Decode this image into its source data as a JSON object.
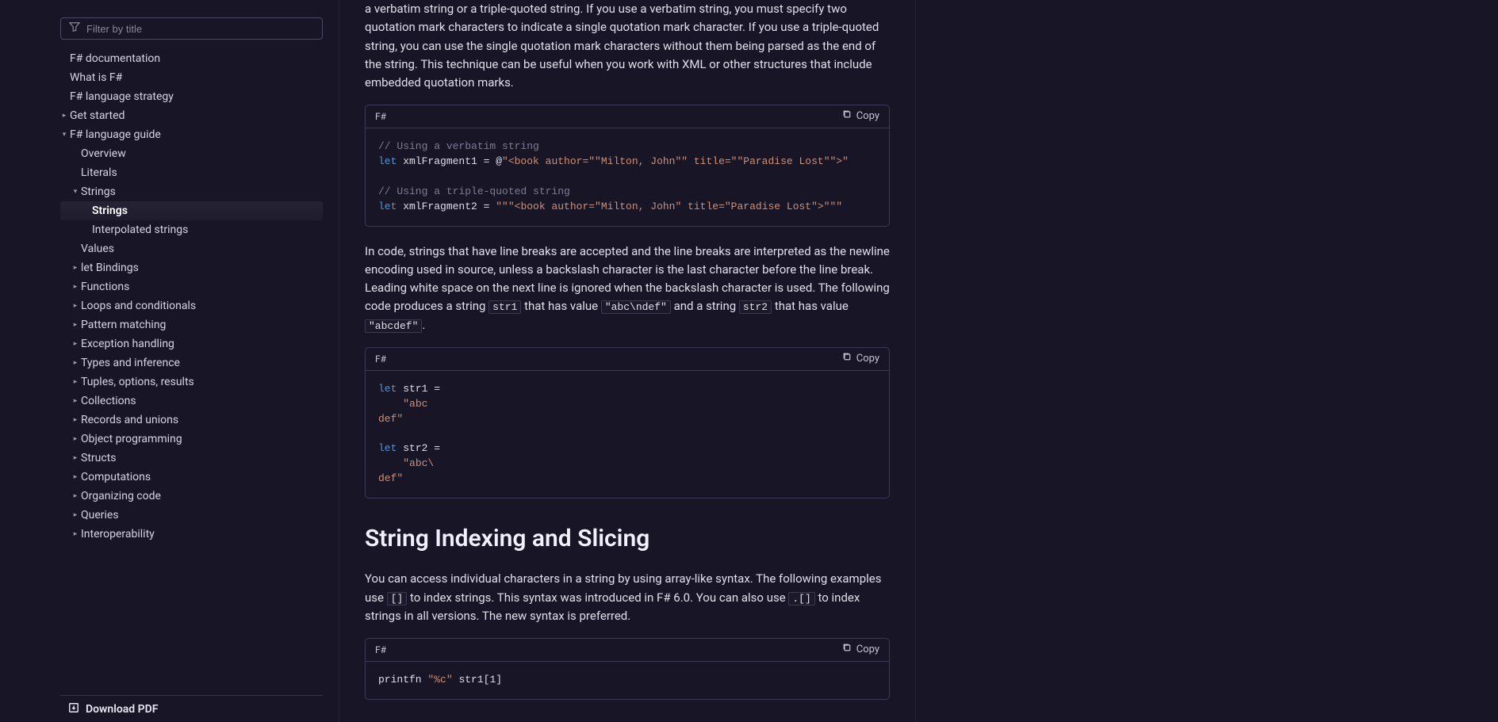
{
  "sidebar": {
    "filter_placeholder": "Filter by title",
    "items": [
      {
        "label": "F# documentation",
        "level": 0,
        "chev": "",
        "active": false
      },
      {
        "label": "What is F#",
        "level": 0,
        "chev": "",
        "active": false
      },
      {
        "label": "F# language strategy",
        "level": 0,
        "chev": "",
        "active": false
      },
      {
        "label": "Get started",
        "level": 0,
        "chev": ">",
        "active": false
      },
      {
        "label": "F# language guide",
        "level": 0,
        "chev": "v",
        "active": false
      },
      {
        "label": "Overview",
        "level": 1,
        "chev": "",
        "active": false
      },
      {
        "label": "Literals",
        "level": 1,
        "chev": "",
        "active": false
      },
      {
        "label": "Strings",
        "level": 1,
        "chev": "v",
        "active": false
      },
      {
        "label": "Strings",
        "level": 2,
        "chev": "",
        "active": true
      },
      {
        "label": "Interpolated strings",
        "level": 2,
        "chev": "",
        "active": false
      },
      {
        "label": "Values",
        "level": 1,
        "chev": "",
        "active": false
      },
      {
        "label": "let Bindings",
        "level": 1,
        "chev": ">",
        "active": false
      },
      {
        "label": "Functions",
        "level": 1,
        "chev": ">",
        "active": false
      },
      {
        "label": "Loops and conditionals",
        "level": 1,
        "chev": ">",
        "active": false
      },
      {
        "label": "Pattern matching",
        "level": 1,
        "chev": ">",
        "active": false
      },
      {
        "label": "Exception handling",
        "level": 1,
        "chev": ">",
        "active": false
      },
      {
        "label": "Types and inference",
        "level": 1,
        "chev": ">",
        "active": false
      },
      {
        "label": "Tuples, options, results",
        "level": 1,
        "chev": ">",
        "active": false
      },
      {
        "label": "Collections",
        "level": 1,
        "chev": ">",
        "active": false
      },
      {
        "label": "Records and unions",
        "level": 1,
        "chev": ">",
        "active": false
      },
      {
        "label": "Object programming",
        "level": 1,
        "chev": ">",
        "active": false
      },
      {
        "label": "Structs",
        "level": 1,
        "chev": ">",
        "active": false
      },
      {
        "label": "Computations",
        "level": 1,
        "chev": ">",
        "active": false
      },
      {
        "label": "Organizing code",
        "level": 1,
        "chev": ">",
        "active": false
      },
      {
        "label": "Queries",
        "level": 1,
        "chev": ">",
        "active": false
      },
      {
        "label": "Interoperability",
        "level": 1,
        "chev": ">",
        "active": false
      }
    ],
    "download_label": "Download PDF"
  },
  "content": {
    "para_intro": "a verbatim string or a triple-quoted string. If you use a verbatim string, you must specify two quotation mark characters to indicate a single quotation mark character. If you use a triple-quoted string, you can use the single quotation mark characters without them being parsed as the end of the string. This technique can be useful when you work with XML or other structures that include embedded quotation marks.",
    "code1": {
      "lang": "F#",
      "copy": "Copy",
      "line1_comment": "// Using a verbatim string",
      "line2_kw": "let",
      "line2_rest": " xmlFragment1 = @",
      "line2_str": "\"<book author=\"\"Milton, John\"\" title=\"\"Paradise Lost\"\">\"",
      "line4_comment": "// Using a triple-quoted string",
      "line5_kw": "let",
      "line5_rest": " xmlFragment2 = ",
      "line5_str": "\"\"\"<book author=\"Milton, John\" title=\"Paradise Lost\">\"\"\""
    },
    "para_linebreak_a": "In code, strings that have line breaks are accepted and the line breaks are interpreted as the newline encoding used in source, unless a backslash character is the last character before the line break. Leading white space on the next line is ignored when the backslash character is used. The following code produces a string ",
    "code_str1": "str1",
    "para_linebreak_b": " that has value ",
    "code_abcndef": "\"abc\\ndef\"",
    "para_linebreak_c": " and a string ",
    "code_str2": "str2",
    "para_linebreak_d": " that has value ",
    "code_abcdef": "\"abcdef\"",
    "para_linebreak_e": ".",
    "code2": {
      "lang": "F#",
      "copy": "Copy",
      "line1_kw": "let",
      "line1_rest": " str1 =",
      "line2_indent": "    ",
      "line2_str": "\"abc",
      "line3_str": "def\"",
      "line5_kw": "let",
      "line5_rest": " str2 =",
      "line6_indent": "    ",
      "line6_str": "\"abc\\",
      "line7_str": "def\""
    },
    "heading_slice": "String Indexing and Slicing",
    "para_slice_a": "You can access individual characters in a string by using array-like syntax. The following examples use ",
    "code_brackets": "[]",
    "para_slice_b": " to index strings. This syntax was introduced in F# 6.0. You can also use ",
    "code_dotbrackets": ".[]",
    "para_slice_c": " to index strings in all versions. The new syntax is preferred.",
    "code3": {
      "lang": "F#",
      "copy": "Copy",
      "line1_a": "printfn ",
      "line1_str": "\"%c\"",
      "line1_b": " str1[1]"
    }
  }
}
